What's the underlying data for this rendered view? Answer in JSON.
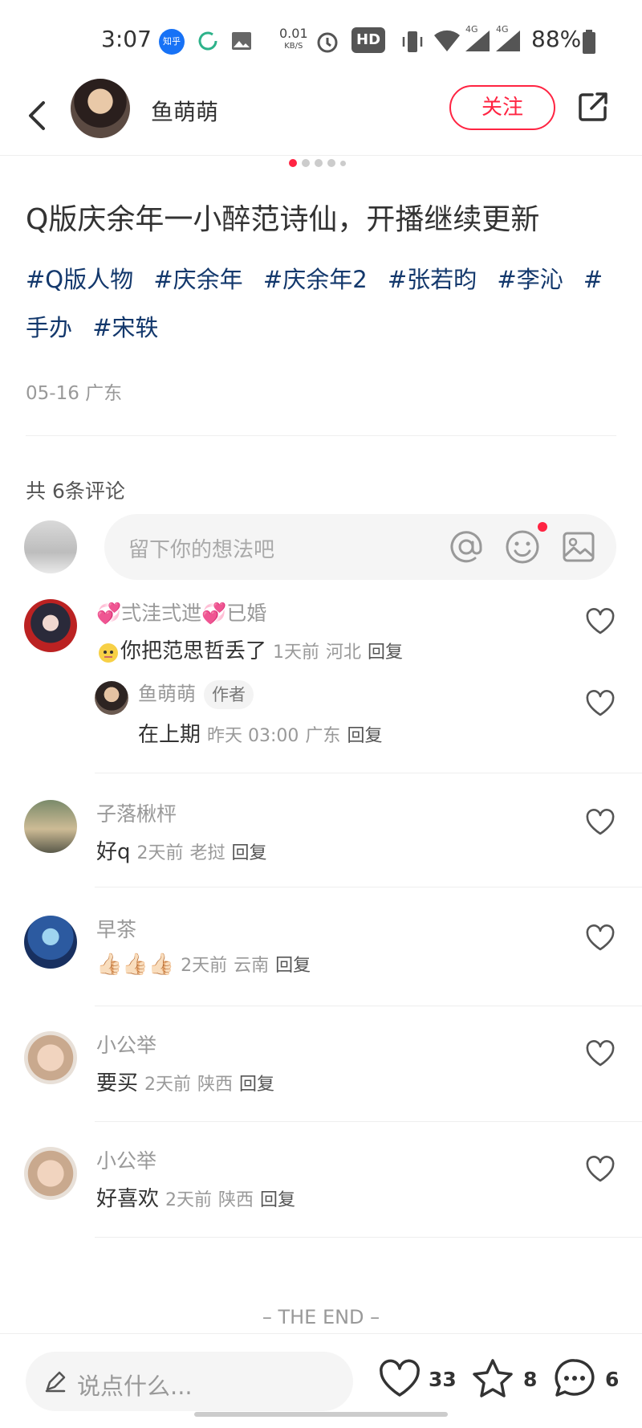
{
  "status_bar": {
    "time": "3:07",
    "zhihu_badge": "知乎",
    "net_speed_value": "0.01",
    "net_speed_unit": "KB/S",
    "hd_label": "HD",
    "signal_label_1": "4G",
    "signal_label_2": "4G",
    "battery": "88%",
    "icons": [
      "zhihu-icon",
      "refresh-icon",
      "image-icon",
      "alarm-icon",
      "vibrate-icon",
      "wifi-icon",
      "signal-icon",
      "battery-icon"
    ]
  },
  "header": {
    "author_name": "鱼萌萌",
    "follow_label": "关注",
    "icons": [
      "back-icon",
      "share-icon"
    ]
  },
  "carousel": {
    "total": 5,
    "active_index": 0
  },
  "post": {
    "title": "Q版庆余年一小醉范诗仙，开播继续更新",
    "tags": [
      "#Q版人物",
      "#庆余年",
      "#庆余年2",
      "#张若昀",
      "#李沁",
      "#手办",
      "#宋轶"
    ],
    "date_location": "05-16 广东"
  },
  "comments_section": {
    "count_label": "共 6条评论",
    "input_placeholder": "留下你的想法吧",
    "icons": [
      "at-icon",
      "emoji-icon",
      "image-icon"
    ]
  },
  "comments": [
    {
      "name": "💞弍洼弍迣💞已婚",
      "text": "你把范思哲丢了",
      "time": "1天前",
      "location": "河北",
      "reply_label": "回复",
      "reply": {
        "name": "鱼萌萌",
        "author_tag": "作者",
        "text": "在上期",
        "time": "昨天 03:00",
        "location": "广东",
        "reply_label": "回复"
      }
    },
    {
      "name": "子落楸枰",
      "text": "好q",
      "time": "2天前",
      "location": "老挝",
      "reply_label": "回复"
    },
    {
      "name": "早茶",
      "text": "👍🏻👍🏻👍🏻",
      "time": "2天前",
      "location": "云南",
      "reply_label": "回复"
    },
    {
      "name": "小公举",
      "text": "要买",
      "time": "2天前",
      "location": "陕西",
      "reply_label": "回复"
    },
    {
      "name": "小公举",
      "text": "好喜欢",
      "time": "2天前",
      "location": "陕西",
      "reply_label": "回复"
    }
  ],
  "end_label": "– THE END –",
  "bottom_bar": {
    "input_placeholder": "说点什么...",
    "like_count": "33",
    "star_count": "8",
    "comment_count": "6"
  },
  "colors": {
    "accent": "#ff2442",
    "tag": "#13386c",
    "muted": "#999999"
  }
}
